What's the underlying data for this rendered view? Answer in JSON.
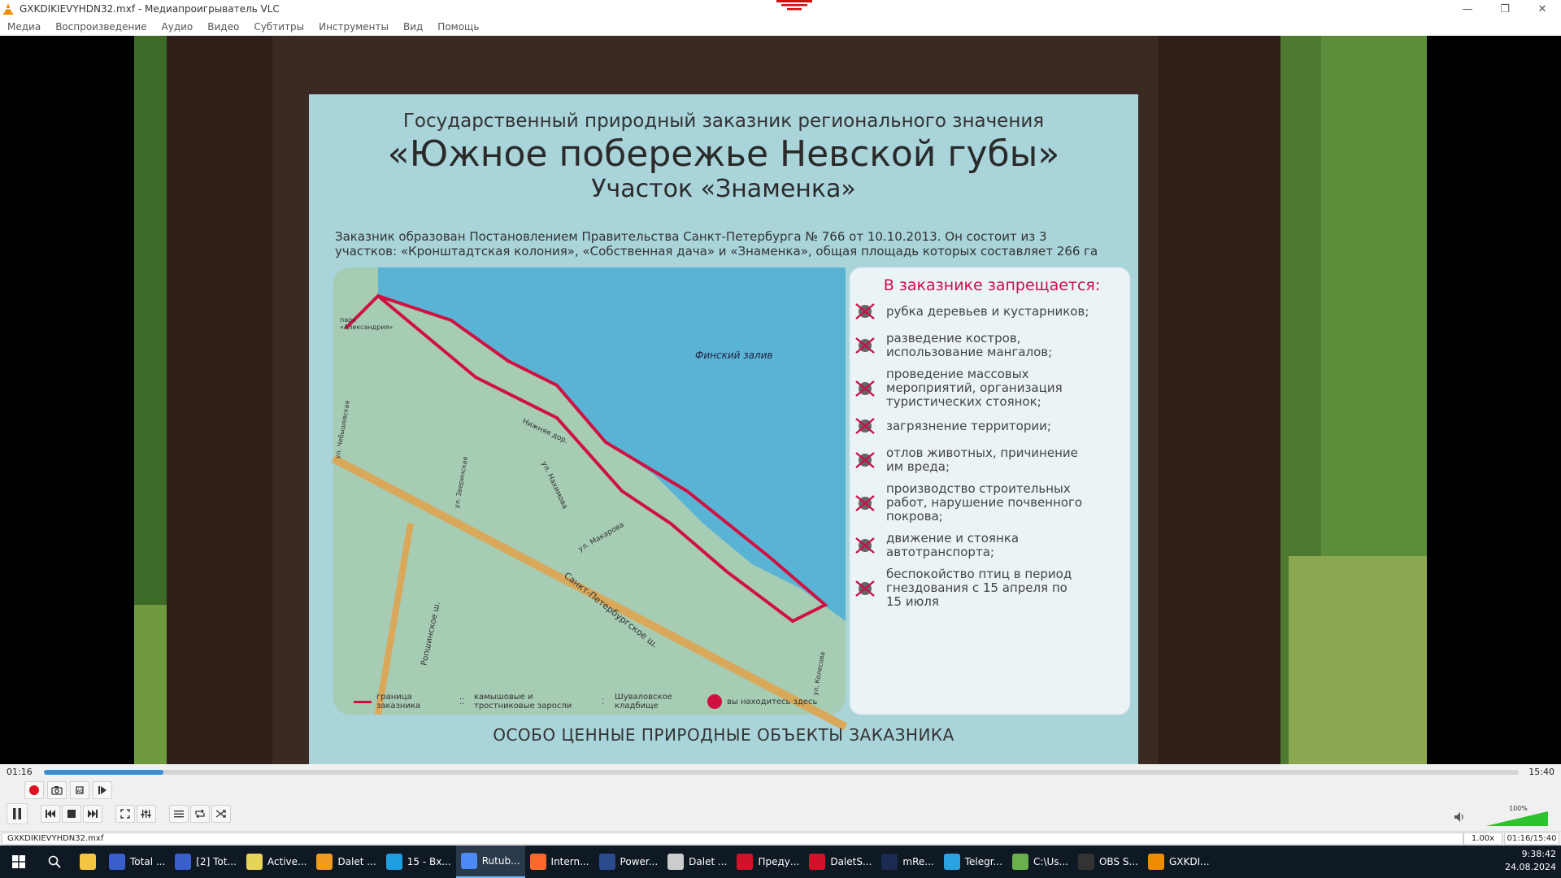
{
  "window": {
    "title": "GXKDIKIEVYHDN32.mxf - Медиапроигрыватель VLC",
    "controls": {
      "minimize": "—",
      "restore": "❐",
      "close": "✕"
    }
  },
  "menu": [
    "Медиа",
    "Воспроизведение",
    "Аудио",
    "Видео",
    "Субтитры",
    "Инструменты",
    "Вид",
    "Помощь"
  ],
  "colors": {
    "accent": "#3b8fd6",
    "vlc_orange": "#f08a00",
    "sign_red": "#d01040",
    "sign_bg": "#a8d4da",
    "map_land": "#a6ccb4",
    "map_water": "#59b3d4",
    "road": "#d9a85a"
  },
  "sign": {
    "line1": "Государственный природный заказник регионального значения",
    "line2": "«Южное побережье Невской губы»",
    "line3": "Участок «Знаменка»",
    "desc1": "Заказник образован Постановлением Правительства Санкт-Петербурга № 766 от 10.10.2013. Он состоит из 3",
    "desc2": "участков: «Кронштадтская колония», «Собственная дача» и «Знаменка», общая площадь которых составляет 266 га",
    "map_labels": {
      "water": "Финский залив",
      "park": "парк «Александрия»",
      "road1": "Нижняя дор.",
      "road2": "ул. Нахимова",
      "road3": "ул. Макарова",
      "highway": "Санкт-Петербургское ш.",
      "highway2": "Ропшинское ш.",
      "street1": "ул. Чебышевская",
      "street2": "ул. Зверинская",
      "street3": "ул. Колесова"
    },
    "legend": [
      "граница заказника",
      "камышовые и тростниковые заросли",
      "Шуваловское кладбище",
      "вы находитесь здесь"
    ],
    "prohibited_title": "В заказнике запрещается:",
    "prohibited": [
      [
        "рубка деревьев и кустарников;"
      ],
      [
        "разведение костров,",
        "использование мангалов;"
      ],
      [
        "проведение массовых",
        "мероприятий, организация",
        "туристических стоянок;"
      ],
      [
        "загрязнение территории;"
      ],
      [
        "отлов животных, причинение",
        "им вреда;"
      ],
      [
        "производство строительных",
        "работ, нарушение почвенного",
        "покрова;"
      ],
      [
        "движение и стоянка",
        "автотранспорта;"
      ],
      [
        "беспокойство птиц в период",
        "гнездования с 15 апреля по",
        "15 июля"
      ]
    ],
    "bottom": "ОСОБО ЦЕННЫЕ ПРИРОДНЫЕ ОБЪЕКТЫ ЗАКАЗНИКА"
  },
  "player": {
    "elapsed": "01:16",
    "total": "15:40",
    "progress": 0.081,
    "volume_pct": "100%",
    "speed": "1.00x",
    "position": "01:16/15:40",
    "file": "GXKDIKIEVYHDN32.mxf"
  },
  "taskbar": {
    "items": [
      {
        "label": "Total ...",
        "icon": "disk-icon",
        "color": "#3a5fcd"
      },
      {
        "label": "[2] Tot...",
        "icon": "disk-icon",
        "color": "#3a5fcd"
      },
      {
        "label": "Active...",
        "icon": "pen-icon",
        "color": "#e6d35a"
      },
      {
        "label": "Dalet ...",
        "icon": "play-icon",
        "color": "#f39a1e"
      },
      {
        "label": "15 - Вх...",
        "icon": "edge-icon",
        "color": "#1e9de1"
      },
      {
        "label": "Rutub...",
        "icon": "chrome-icon",
        "color": "#4c8bf5"
      },
      {
        "label": "Intern...",
        "icon": "firefox-icon",
        "color": "#ff6a2b"
      },
      {
        "label": "Power...",
        "icon": "terminal-icon",
        "color": "#2b4b8f"
      },
      {
        "label": "Dalet ...",
        "icon": "pen-icon",
        "color": "#cccccc"
      },
      {
        "label": "Преду...",
        "icon": "opera-icon",
        "color": "#d1132a"
      },
      {
        "label": "DaletS...",
        "icon": "dalet-icon",
        "color": "#d1132a"
      },
      {
        "label": "mRe...",
        "icon": "mre-icon",
        "color": "#1a2a50"
      },
      {
        "label": "Telegr...",
        "icon": "telegram-icon",
        "color": "#2aa3e0"
      },
      {
        "label": "C:\\Us...",
        "icon": "folder-icon",
        "color": "#6ab04c"
      },
      {
        "label": "OBS S...",
        "icon": "obs-icon",
        "color": "#333333"
      },
      {
        "label": "GXKDI...",
        "icon": "vlc-icon",
        "color": "#f08a00"
      }
    ],
    "clock_time": "9:38:42",
    "clock_date": "24.08.2024"
  }
}
